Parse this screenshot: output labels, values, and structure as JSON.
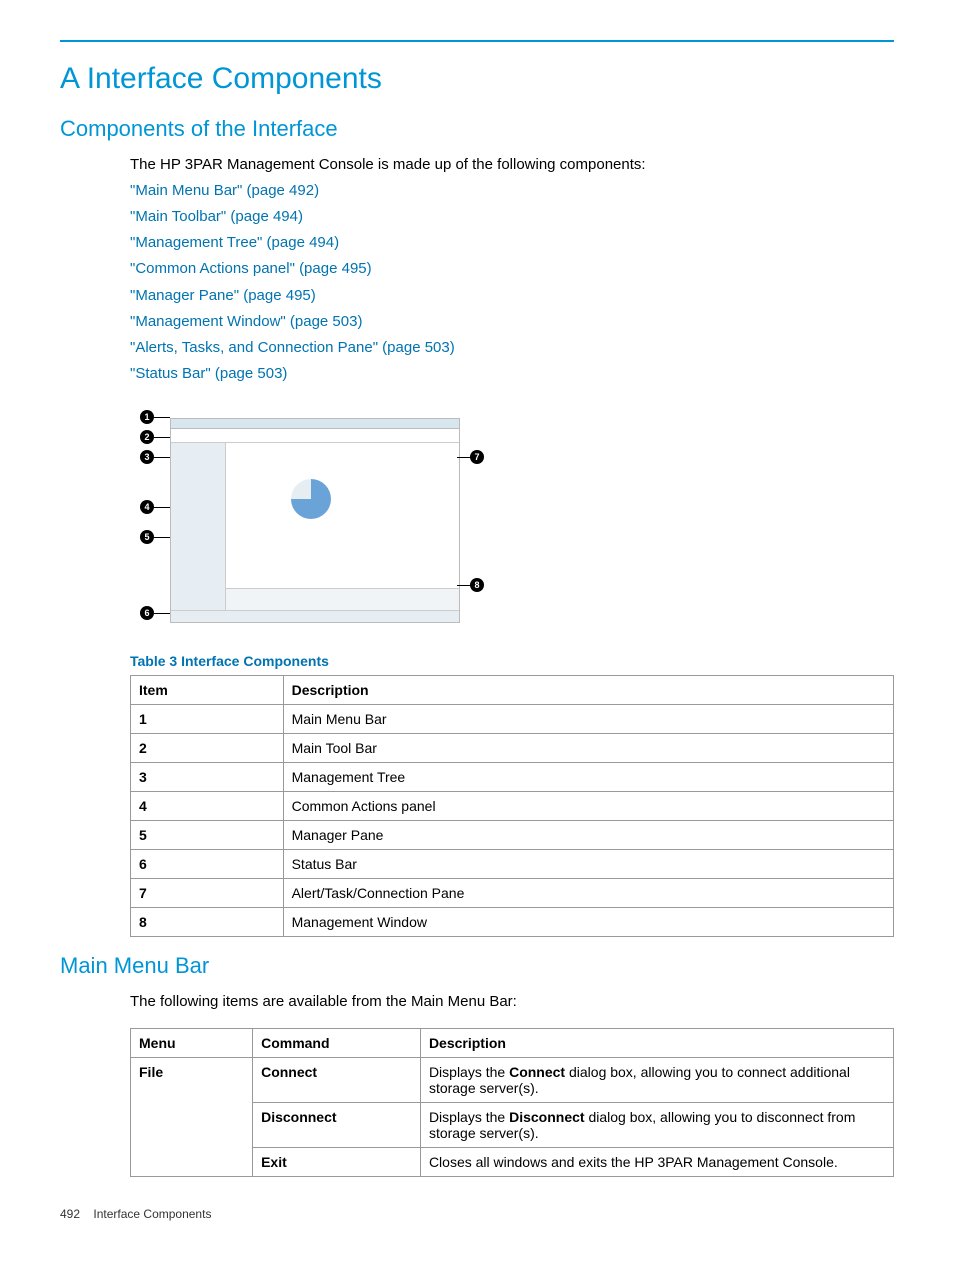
{
  "page": {
    "title": "A Interface Components",
    "section1_title": "Components of the Interface",
    "intro": "The HP 3PAR Management Console is made up of the following components:",
    "links": [
      "\"Main Menu Bar\" (page 492)",
      "\"Main Toolbar\" (page 494)",
      "\"Management Tree\" (page 494)",
      "\"Common Actions panel\" (page 495)",
      "\"Manager Pane\" (page 495)",
      "\"Management Window\" (page 503)",
      "\"Alerts, Tasks, and Connection Pane\" (page 503)",
      "\"Status Bar\" (page 503)"
    ],
    "table3_caption": "Table 3 Interface Components",
    "table3_headers": {
      "item": "Item",
      "desc": "Description"
    },
    "table3_rows": [
      {
        "item": "1",
        "desc": "Main Menu Bar"
      },
      {
        "item": "2",
        "desc": "Main Tool Bar"
      },
      {
        "item": "3",
        "desc": "Management Tree"
      },
      {
        "item": "4",
        "desc": "Common Actions panel"
      },
      {
        "item": "5",
        "desc": "Manager Pane"
      },
      {
        "item": "6",
        "desc": "Status Bar"
      },
      {
        "item": "7",
        "desc": "Alert/Task/Connection Pane"
      },
      {
        "item": "8",
        "desc": "Management Window"
      }
    ],
    "section2_title": "Main Menu Bar",
    "section2_intro": "The following items are available from the Main Menu Bar:",
    "menu_headers": {
      "menu": "Menu",
      "command": "Command",
      "desc": "Description"
    },
    "menu_rows": [
      {
        "menu": "File",
        "command": "Connect",
        "desc_pre": "Displays the ",
        "desc_bold": "Connect",
        "desc_post": " dialog box, allowing you to connect additional storage server(s)."
      },
      {
        "menu": "",
        "command": "Disconnect",
        "desc_pre": "Displays the ",
        "desc_bold": "Disconnect",
        "desc_post": " dialog box, allowing you to disconnect from storage server(s)."
      },
      {
        "menu": "",
        "command": "Exit",
        "desc_pre": "",
        "desc_bold": "",
        "desc_post": "Closes all windows and exits the HP 3PAR Management Console."
      }
    ],
    "footer_page": "492",
    "footer_text": "Interface Components",
    "callouts": [
      "1",
      "2",
      "3",
      "4",
      "5",
      "6",
      "7",
      "8"
    ]
  }
}
